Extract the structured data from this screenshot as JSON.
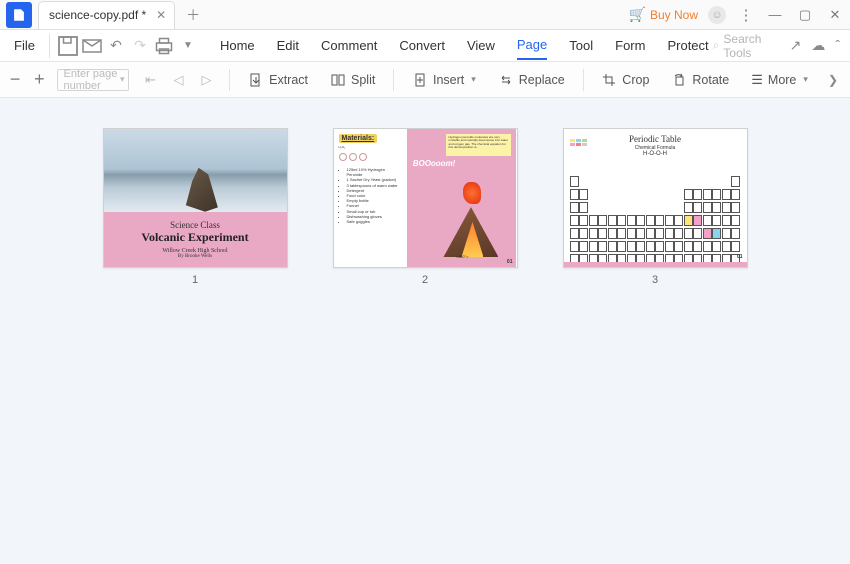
{
  "titlebar": {
    "tab_name": "science-copy.pdf *",
    "buy_label": "Buy Now"
  },
  "menubar": {
    "file": "File",
    "items": [
      "Home",
      "Edit",
      "Comment",
      "Convert",
      "View",
      "Page",
      "Tool",
      "Form",
      "Protect"
    ],
    "active_index": 5,
    "search_placeholder": "Search Tools"
  },
  "toolbar": {
    "page_placeholder": "Enter page number",
    "extract": "Extract",
    "split": "Split",
    "insert": "Insert",
    "replace": "Replace",
    "crop": "Crop",
    "rotate": "Rotate",
    "more": "More"
  },
  "pages": [
    {
      "number": "1",
      "title_small": "Science Class",
      "title_main": "Volcanic Experiment",
      "subtitle1": "Willow Creek High School",
      "subtitle2": "By Brooke Wells"
    },
    {
      "number": "2",
      "materials_label": "Materials:",
      "boom": "BOOooom!",
      "page_badge": "01",
      "materials": [
        "125ml 10% Hydrogen Peroxide",
        "1 Sachet Dry Yeast (packet)",
        "3 tablespoons of warm water",
        "Detergent",
        "Food color",
        "Empty bottle",
        "Funnel",
        "Small cup or tub",
        "Dishwashing gloves",
        "Safe goggles"
      ]
    },
    {
      "number": "3",
      "title": "Periodic Table",
      "sub1": "Chemical Formula",
      "sub2": "H-O-O-H",
      "page_badge": "01"
    }
  ]
}
